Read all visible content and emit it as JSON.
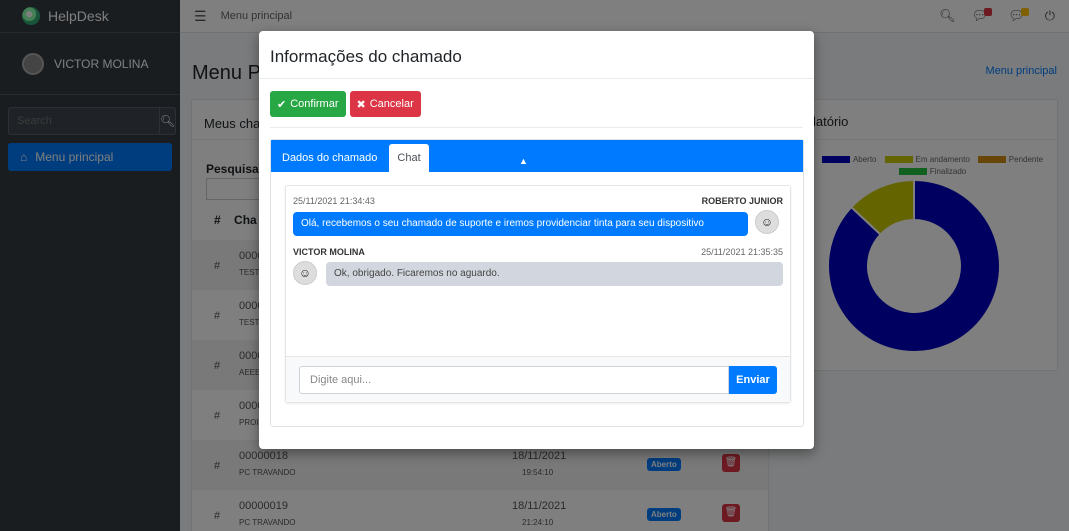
{
  "sidebar": {
    "brand": "HelpDesk",
    "user": "VICTOR MOLINA",
    "search_placeholder": "Search",
    "menu_item": "Menu principal"
  },
  "topnav": {
    "crumb": "Menu principal"
  },
  "page": {
    "title": "Menu Pr",
    "breadcrumb": "Menu principal"
  },
  "left_card": {
    "title": "Meus char",
    "search_label": "Pesquisar:",
    "col_hash": "#",
    "col_cha": "Cha",
    "rows": [
      {
        "hash": "#",
        "code": "0000",
        "sub": "TEST",
        "date": "",
        "time": "",
        "badge": ""
      },
      {
        "hash": "#",
        "code": "0000",
        "sub": "TEST",
        "date": "",
        "time": "",
        "badge": ""
      },
      {
        "hash": "#",
        "code": "0000",
        "sub": "AEEE",
        "date": "",
        "time": "",
        "badge": ""
      },
      {
        "hash": "#",
        "code": "0000",
        "sub": "PROI",
        "date": "",
        "time": "",
        "badge": ""
      },
      {
        "hash": "#",
        "code": "00000018",
        "sub": "PC TRAVANDO",
        "date": "18/11/2021",
        "time": "19:54:10",
        "badge": "Aberto"
      },
      {
        "hash": "#",
        "code": "00000019",
        "sub": "PC TRAVANDO",
        "date": "18/11/2021",
        "time": "21:24:10",
        "badge": "Aberto"
      }
    ]
  },
  "right_card": {
    "title": "latório"
  },
  "chart_data": {
    "type": "pie",
    "categories": [
      "Aberto",
      "Em andamento",
      "Pendente",
      "Finalizado"
    ],
    "values": [
      87,
      13,
      0,
      0
    ],
    "colors": [
      "#0000c0",
      "#c8c800",
      "#d08a10",
      "#22c040"
    ],
    "legend": "top"
  },
  "modal": {
    "title": "Informações do chamado",
    "confirm": "Confirmar",
    "cancel": "Cancelar",
    "tab_data": "Dados do chamado",
    "tab_chat": "Chat",
    "messages": [
      {
        "time": "25/11/2021 21:34:43",
        "name": "ROBERTO JUNIOR",
        "text": "Olá, recebemos o seu chamado de suporte e iremos providenciar tinta para seu dispositivo"
      },
      {
        "time": "25/11/2021 21:35:35",
        "name": "VICTOR MOLINA",
        "text": "Ok, obrigado. Ficaremos no aguardo."
      }
    ],
    "input_placeholder": "Digite aqui...",
    "send": "Enviar"
  }
}
